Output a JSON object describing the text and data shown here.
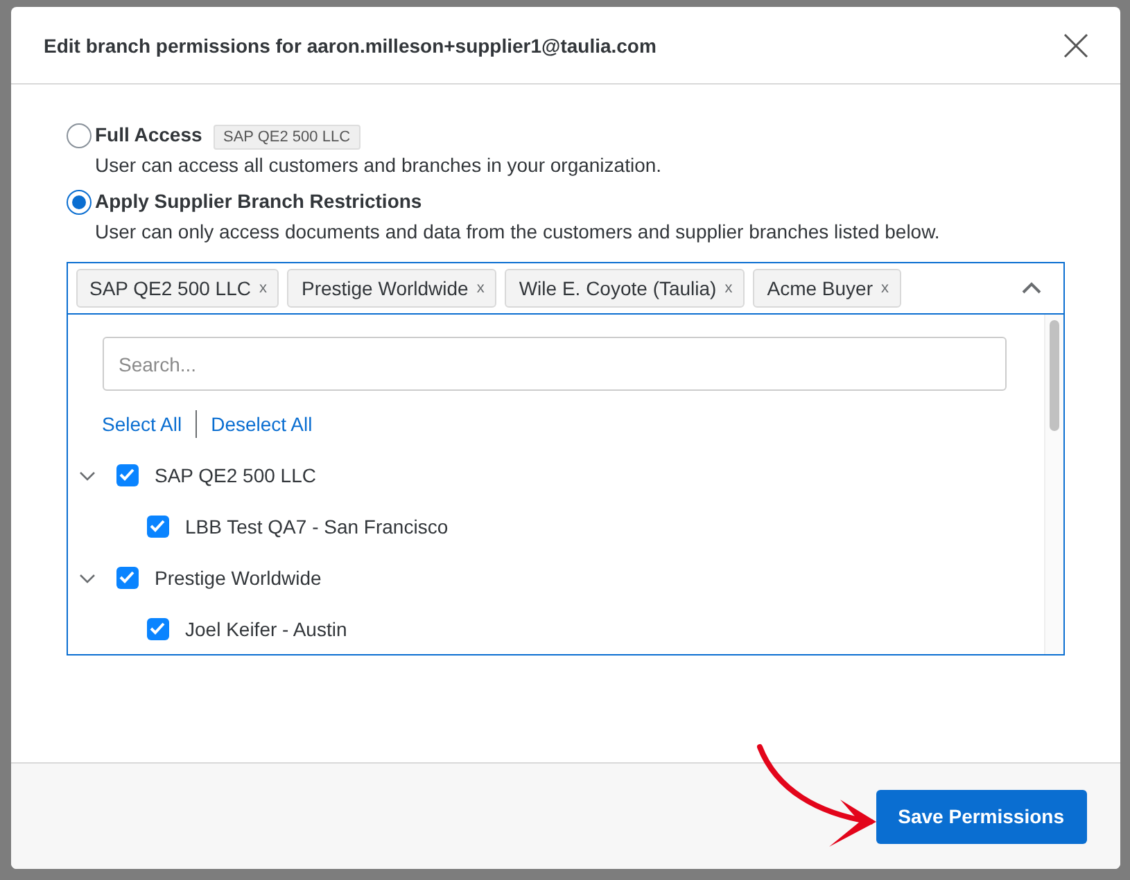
{
  "dialog": {
    "title": "Edit branch permissions for aaron.milleson+supplier1@taulia.com",
    "options": [
      {
        "label": "Full Access",
        "description": "User can access all customers and branches in your organization.",
        "selected": false
      },
      {
        "label": "Apply Supplier Branch Restrictions",
        "description": "User can only access documents and data from the customers and supplier branches listed below.",
        "selected": true
      }
    ],
    "tooltip": "SAP QE2 500 LLC",
    "picker": {
      "expanded": true,
      "tags": [
        {
          "label": "SAP QE2 500 LLC",
          "remove": "x"
        },
        {
          "label": "Prestige Worldwide",
          "remove": "x"
        },
        {
          "label": "Wile E. Coyote (Taulia)",
          "remove": "x"
        },
        {
          "label": "Acme Buyer",
          "remove": "x"
        }
      ],
      "search": {
        "placeholder": "Search..."
      },
      "links": [
        "Select All",
        "Deselect All"
      ],
      "tree": [
        {
          "label": "SAP QE2 500 LLC",
          "checked": true,
          "expanded": true,
          "children": [
            {
              "label": "LBB Test QA7 - San Francisco",
              "checked": true
            }
          ]
        },
        {
          "label": "Prestige Worldwide",
          "checked": true,
          "expanded": true,
          "children": [
            {
              "label": "Joel Keifer - Austin",
              "checked": true
            }
          ]
        }
      ]
    },
    "save_button": "Save Permissions"
  }
}
